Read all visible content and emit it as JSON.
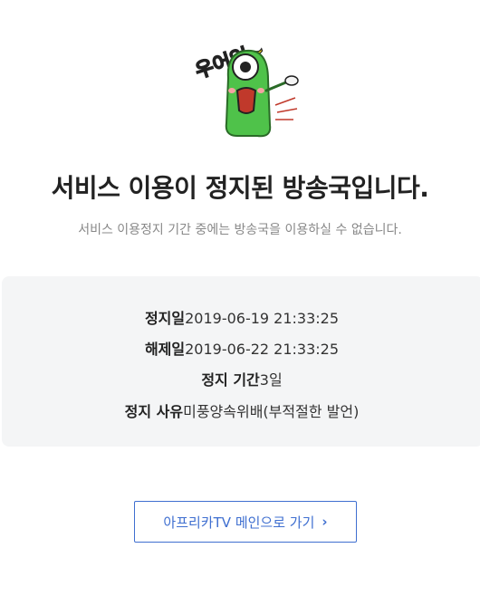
{
  "mascot": {
    "sticker_text": "우어엉~",
    "icon": "shocked-green-character-icon"
  },
  "title": "서비스 이용이 정지된 방송국입니다.",
  "subtitle": "서비스 이용정지 기간 중에는 방송국을 이용하실 수 없습니다.",
  "info": {
    "suspend_date_label": "정지일",
    "suspend_date_value": "2019-06-19 21:33:25",
    "release_date_label": "해제일",
    "release_date_value": "2019-06-22 21:33:25",
    "period_label": "정지 기간",
    "period_value": "3일",
    "reason_label": "정지 사유",
    "reason_value": "미풍양속위배(부적절한 발언)"
  },
  "button": {
    "label": "아프리카TV 메인으로 가기",
    "icon": "chevron-right-icon",
    "accent": "#3f6fd0"
  },
  "colors": {
    "background": "#ffffff",
    "box": "#f4f5f6",
    "accent": "#3f6fd0"
  }
}
